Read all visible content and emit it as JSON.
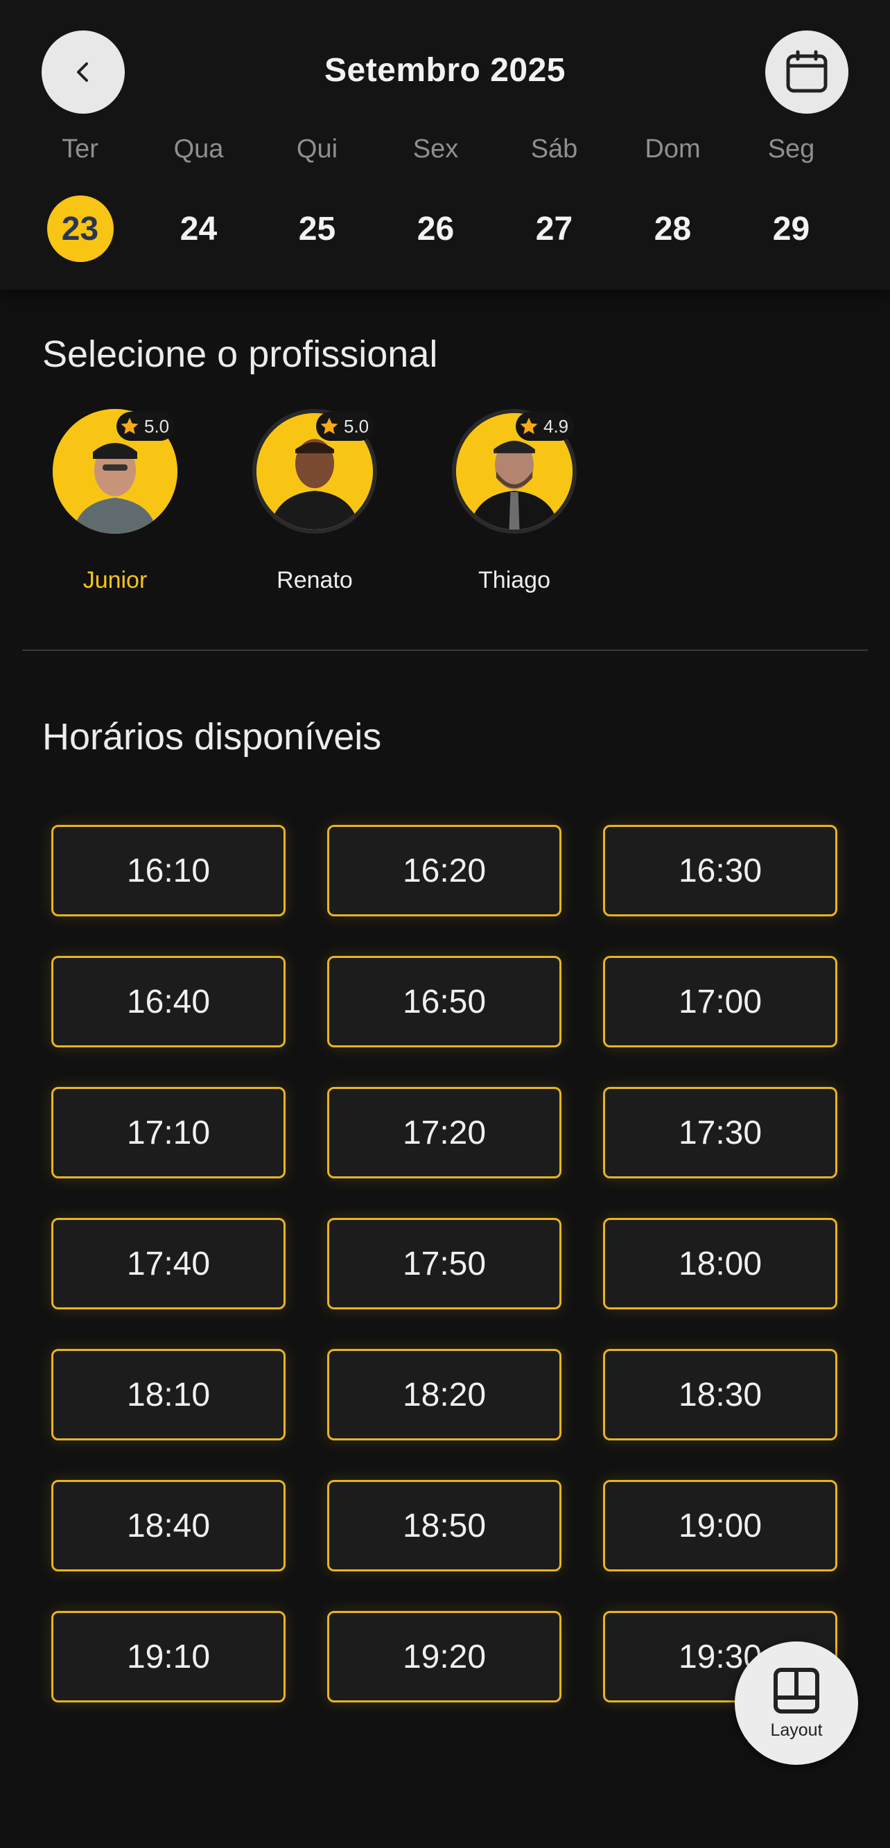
{
  "header": {
    "month_title": "Setembro 2025",
    "back_icon": "chevron-left-icon",
    "calendar_icon": "calendar-icon"
  },
  "week": [
    {
      "name": "Ter",
      "num": "23",
      "selected": true
    },
    {
      "name": "Qua",
      "num": "24",
      "selected": false
    },
    {
      "name": "Qui",
      "num": "25",
      "selected": false
    },
    {
      "name": "Sex",
      "num": "26",
      "selected": false
    },
    {
      "name": "Sáb",
      "num": "27",
      "selected": false
    },
    {
      "name": "Dom",
      "num": "28",
      "selected": false
    },
    {
      "name": "Seg",
      "num": "29",
      "selected": false
    }
  ],
  "professionals_section": {
    "title": "Selecione o profissional",
    "items": [
      {
        "name": "Junior",
        "rating": "5.0",
        "selected": true
      },
      {
        "name": "Renato",
        "rating": "5.0",
        "selected": false
      },
      {
        "name": "Thiago",
        "rating": "4.9",
        "selected": false
      }
    ]
  },
  "slots_section": {
    "title": "Horários disponíveis",
    "times": [
      "16:10",
      "16:20",
      "16:30",
      "16:40",
      "16:50",
      "17:00",
      "17:10",
      "17:20",
      "17:30",
      "17:40",
      "17:50",
      "18:00",
      "18:10",
      "18:20",
      "18:30",
      "18:40",
      "18:50",
      "19:00",
      "19:10",
      "19:20",
      "19:30"
    ]
  },
  "fab": {
    "label": "Layout",
    "icon": "layout-icon"
  },
  "colors": {
    "accent": "#f8c514",
    "background": "#111111",
    "slot_border": "#e8b422"
  }
}
